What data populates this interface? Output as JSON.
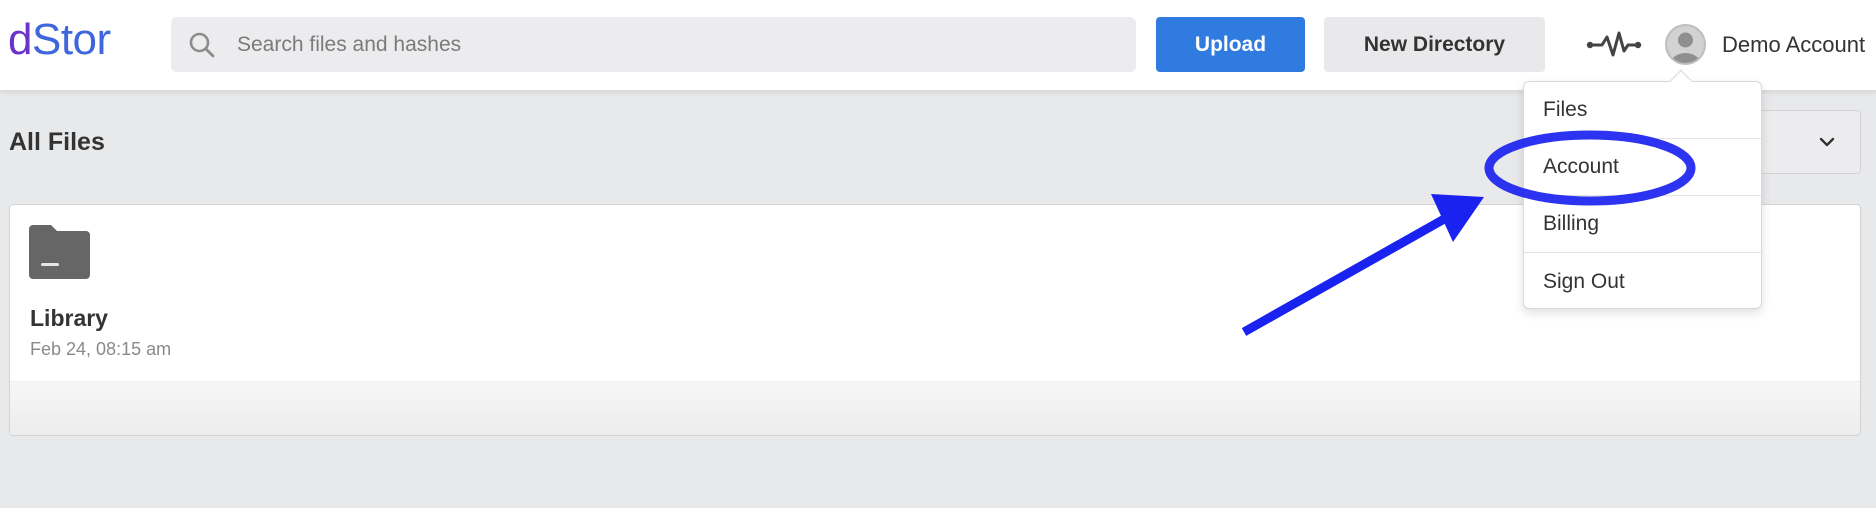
{
  "header": {
    "logo_part1": "d",
    "logo_part2": "Stor",
    "search_placeholder": "Search files and hashes",
    "upload_label": "Upload",
    "new_directory_label": "New Directory",
    "account_name": "Demo Account"
  },
  "main": {
    "title": "All Files",
    "items": [
      {
        "name": "Library",
        "date": "Feb 24, 08:15 am"
      }
    ]
  },
  "account_menu": {
    "items": [
      {
        "label": "Files"
      },
      {
        "label": "Account"
      },
      {
        "label": "Billing"
      },
      {
        "label": "Sign Out"
      }
    ]
  },
  "icons": [
    "search-icon",
    "activity-icon",
    "avatar-icon",
    "chevron-down-icon",
    "folder-icon"
  ],
  "colors": {
    "primary_button": "#2f7be0",
    "logo_purple": "#6a33c9",
    "logo_blue": "#3e67dd",
    "annotation_blue": "#1a22f0"
  }
}
